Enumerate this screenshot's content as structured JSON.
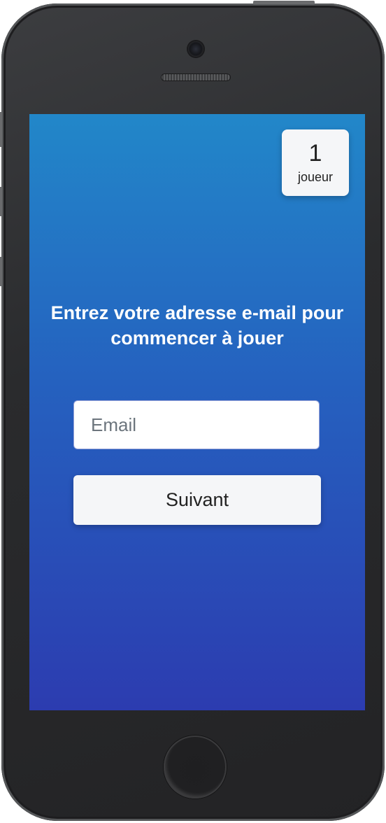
{
  "device": {
    "icons": {
      "camera": "camera-icon",
      "speaker": "speaker-grille-icon",
      "home": "home-button-icon"
    }
  },
  "players": {
    "count": "1",
    "label": "joueur"
  },
  "prompt": {
    "line1": "Entrez votre adresse e-mail pour",
    "line2": "commencer à jouer"
  },
  "form": {
    "email_placeholder": "Email",
    "email_value": "",
    "next_label": "Suivant"
  },
  "colors": {
    "screen_gradient_top": "#2287c9",
    "screen_gradient_bottom": "#2c3cb0",
    "card_background": "#f5f6f8",
    "prompt_text": "#ffffff"
  }
}
